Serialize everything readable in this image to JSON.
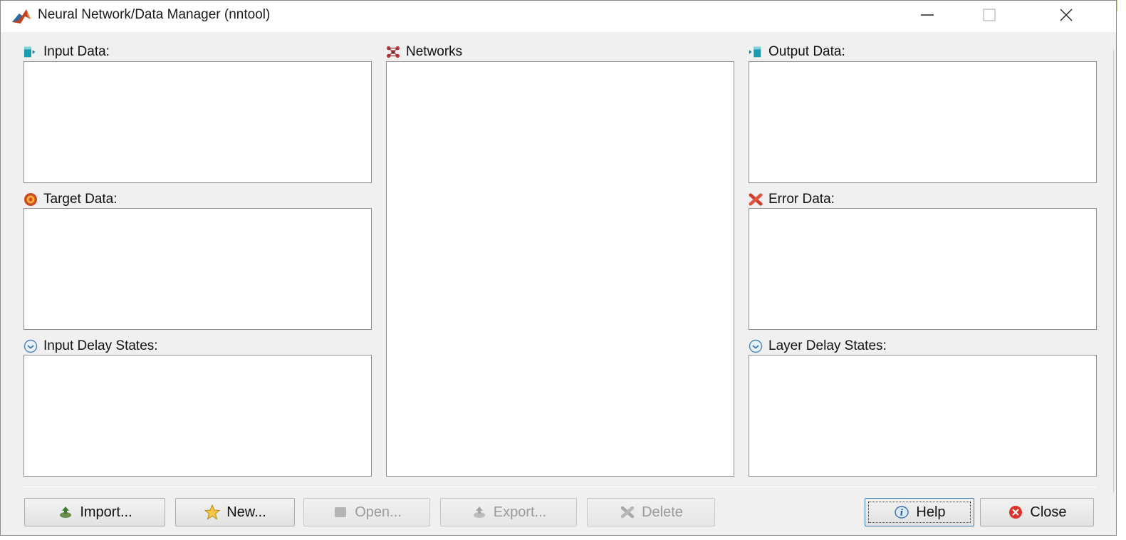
{
  "window": {
    "title": "Neural Network/Data Manager (nntool)",
    "title_icon": "matlab-logo-icon",
    "controls": [
      "minimize-icon",
      "maximize-icon",
      "close-window-icon"
    ]
  },
  "panels": {
    "input_data": {
      "label": "Input Data:",
      "icon": "input-data-icon",
      "items": []
    },
    "target_data": {
      "label": "Target Data:",
      "icon": "target-icon",
      "items": []
    },
    "input_delay_states": {
      "label": "Input Delay States:",
      "icon": "delay-states-icon",
      "items": []
    },
    "networks": {
      "label": "Networks",
      "icon": "network-icon",
      "items": []
    },
    "output_data": {
      "label": "Output Data:",
      "icon": "output-data-icon",
      "items": []
    },
    "error_data": {
      "label": "Error Data:",
      "icon": "error-icon",
      "items": []
    },
    "layer_delay_states": {
      "label": "Layer Delay States:",
      "icon": "delay-states-icon",
      "items": []
    }
  },
  "buttons": {
    "import": {
      "label": "Import...",
      "icon": "import-icon",
      "enabled": true
    },
    "new": {
      "label": "New...",
      "icon": "new-star-icon",
      "enabled": true
    },
    "open": {
      "label": "Open...",
      "icon": "open-icon",
      "enabled": false
    },
    "export": {
      "label": "Export...",
      "icon": "export-icon",
      "enabled": false
    },
    "delete": {
      "label": "Delete",
      "icon": "delete-icon",
      "enabled": false
    },
    "help": {
      "label": "Help",
      "icon": "help-info-icon",
      "enabled": true
    },
    "close": {
      "label": "Close",
      "icon": "close-circle-icon",
      "enabled": true
    }
  },
  "colors": {
    "window_bg": "#f0f0f0",
    "list_bg": "#ffffff",
    "disabled_text": "#9a9a9a",
    "focus_border": "#3c7fb1"
  }
}
